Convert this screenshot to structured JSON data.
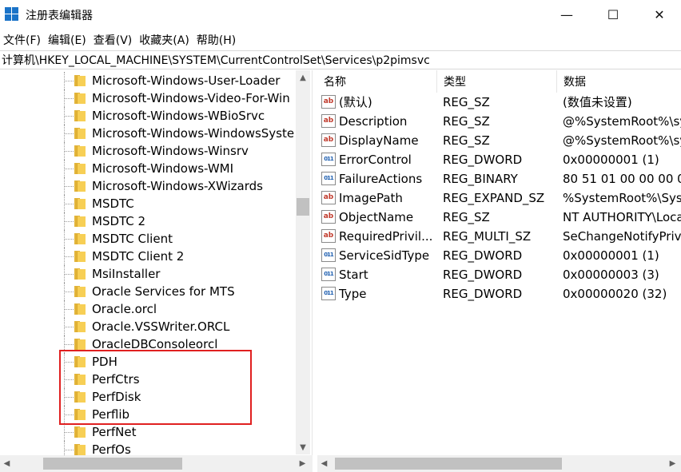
{
  "window": {
    "title": "注册表编辑器",
    "minimize_glyph": "—",
    "maximize_glyph": "☐",
    "close_glyph": "✕"
  },
  "menu": [
    "文件(F)",
    "编辑(E)",
    "查看(V)",
    "收藏夹(A)",
    "帮助(H)"
  ],
  "address": "计算机\\HKEY_LOCAL_MACHINE\\SYSTEM\\CurrentControlSet\\Services\\p2pimsvc",
  "tree": [
    "Microsoft-Windows-User-Loader",
    "Microsoft-Windows-Video-For-Win",
    "Microsoft-Windows-WBioSrvc",
    "Microsoft-Windows-WindowsSyste",
    "Microsoft-Windows-Winsrv",
    "Microsoft-Windows-WMI",
    "Microsoft-Windows-XWizards",
    "MSDTC",
    "MSDTC 2",
    "MSDTC Client",
    "MSDTC Client 2",
    "MsiInstaller",
    "Oracle Services for MTS",
    "Oracle.orcl",
    "Oracle.VSSWriter.ORCL",
    "OracleDBConsoleorcl",
    "PDH",
    "PerfCtrs",
    "PerfDisk",
    "Perflib",
    "PerfNet",
    "PerfOs"
  ],
  "columns": {
    "name": "名称",
    "type": "类型",
    "data": "数据"
  },
  "values": [
    {
      "name": "(默认)",
      "type": "REG_SZ",
      "data": "(数值未设置)",
      "icon": "ab"
    },
    {
      "name": "Description",
      "type": "REG_SZ",
      "data": "@%SystemRoot%\\sy",
      "icon": "ab"
    },
    {
      "name": "DisplayName",
      "type": "REG_SZ",
      "data": "@%SystemRoot%\\sy",
      "icon": "ab"
    },
    {
      "name": "ErrorControl",
      "type": "REG_DWORD",
      "data": "0x00000001 (1)",
      "icon": "bin"
    },
    {
      "name": "FailureActions",
      "type": "REG_BINARY",
      "data": "80 51 01 00 00 00 00",
      "icon": "bin"
    },
    {
      "name": "ImagePath",
      "type": "REG_EXPAND_SZ",
      "data": "%SystemRoot%\\Syst",
      "icon": "ab"
    },
    {
      "name": "ObjectName",
      "type": "REG_SZ",
      "data": "NT AUTHORITY\\Loca",
      "icon": "ab"
    },
    {
      "name": "RequiredPrivil...",
      "type": "REG_MULTI_SZ",
      "data": "SeChangeNotifyPrivi",
      "icon": "ab"
    },
    {
      "name": "ServiceSidType",
      "type": "REG_DWORD",
      "data": "0x00000001 (1)",
      "icon": "bin"
    },
    {
      "name": "Start",
      "type": "REG_DWORD",
      "data": "0x00000003 (3)",
      "icon": "bin"
    },
    {
      "name": "Type",
      "type": "REG_DWORD",
      "data": "0x00000020 (32)",
      "icon": "bin"
    }
  ],
  "colors": {
    "highlight_border": "#e02020",
    "folder": "#f7cf55",
    "app_icon": "#1a73c8"
  }
}
